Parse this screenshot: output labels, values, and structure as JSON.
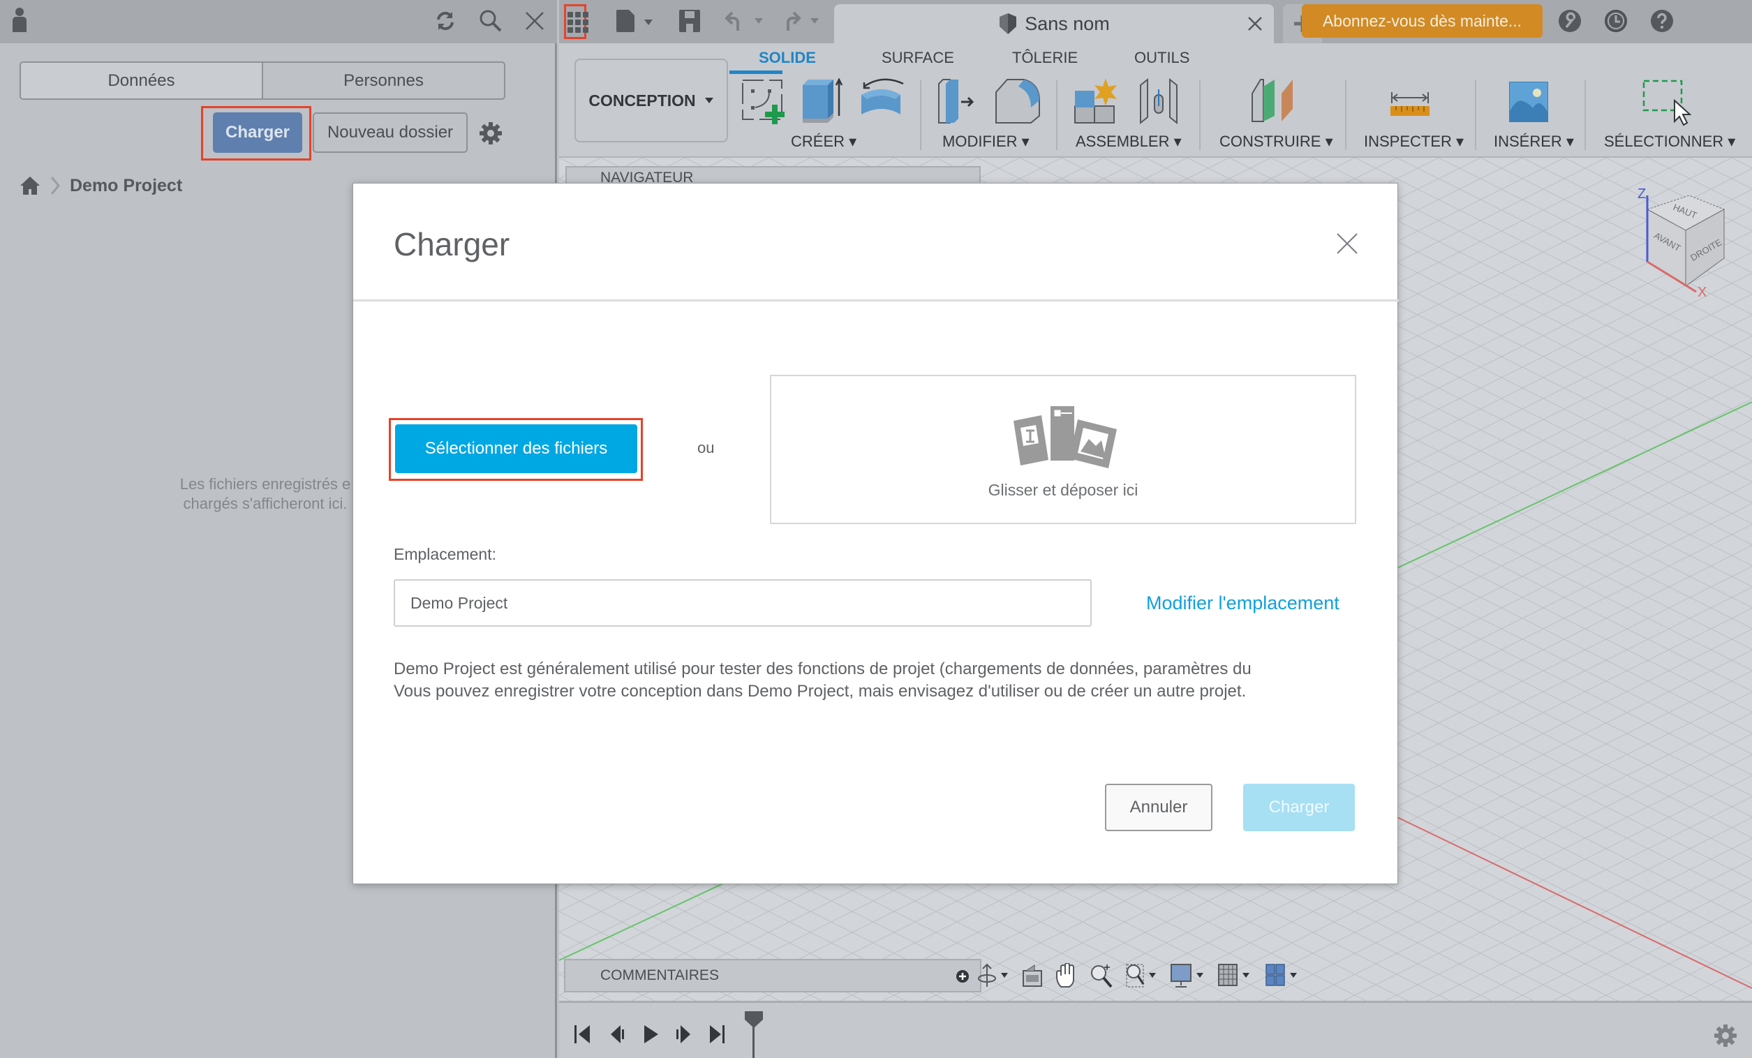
{
  "left_panel": {
    "tabs": [
      {
        "label": "Données",
        "active": true
      },
      {
        "label": "Personnes",
        "active": false
      }
    ],
    "upload_label": "Charger",
    "new_folder_label": "Nouveau dossier",
    "breadcrumb": {
      "project": "Demo Project"
    },
    "empty_message_line1": "Les fichiers enregistrés e",
    "empty_message_line2": "chargés s'afficheront ici."
  },
  "header": {
    "document_title": "Sans nom",
    "subscribe_label": "Abonnez-vous dès mainte..."
  },
  "toolbar": {
    "workspace": "CONCEPTION",
    "tabs": [
      {
        "label": "SOLIDE",
        "active": true
      },
      {
        "label": "SURFACE",
        "active": false
      },
      {
        "label": "TÔLERIE",
        "active": false
      },
      {
        "label": "OUTILS",
        "active": false
      }
    ],
    "groups": [
      "CRÉER",
      "MODIFIER",
      "ASSEMBLER",
      "CONSTRUIRE",
      "INSPECTER",
      "INSÉRER",
      "SÉLECTIONNER"
    ]
  },
  "viewport": {
    "navigator_label": "NAVIGATEUR",
    "comments_label": "COMMENTAIRES",
    "viewcube": {
      "top": "HAUT",
      "front": "AVANT",
      "right": "DROITE",
      "axis_z": "Z",
      "axis_x": "X"
    }
  },
  "dialog": {
    "title": "Charger",
    "select_files_label": "Sélectionner des fichiers",
    "or_label": "ou",
    "drop_label": "Glisser et déposer ici",
    "location_label": "Emplacement:",
    "location_value": "Demo Project",
    "modify_location_label": "Modifier l'emplacement",
    "description_line1": "Demo Project est généralement utilisé pour tester des fonctions de projet (chargements de données, paramètres du",
    "description_line2": "Vous pouvez enregistrer votre conception dans Demo Project, mais envisagez d'utiliser ou de créer un autre projet.",
    "cancel_label": "Annuler",
    "submit_label": "Charger"
  },
  "colors": {
    "accent_blue": "#00a8e3",
    "link_blue": "#10a0dd",
    "highlight_red": "#e5432a",
    "subscribe_orange": "#d18a24",
    "tab_active": "#1f86c6"
  }
}
